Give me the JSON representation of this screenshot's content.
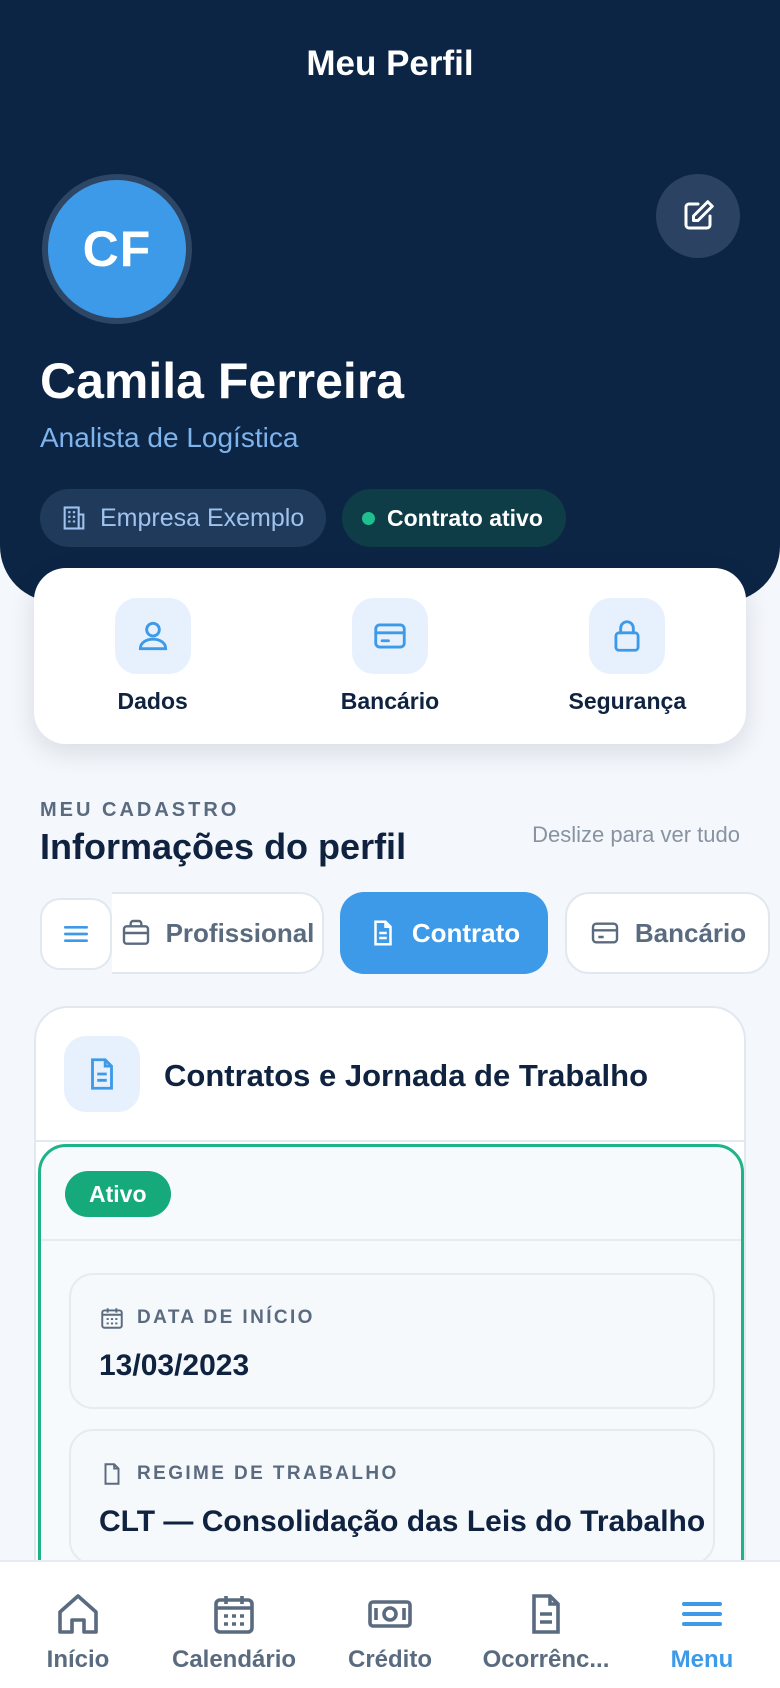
{
  "header": {
    "title": "Meu Perfil"
  },
  "profile": {
    "initials": "CF",
    "name": "Camila Ferreira",
    "role": "Analista de Logística",
    "company": "Empresa Exemplo",
    "contract_status": "Contrato ativo"
  },
  "quick_actions": [
    {
      "label": "Dados",
      "icon": "user-icon"
    },
    {
      "label": "Bancário",
      "icon": "card-icon"
    },
    {
      "label": "Segurança",
      "icon": "lock-icon"
    }
  ],
  "section": {
    "kicker": "MEU CADASTRO",
    "title": "Informações do perfil",
    "hint": "Deslize para ver tudo"
  },
  "tabs": [
    {
      "label": "Profissional",
      "icon": "briefcase-icon",
      "active": false
    },
    {
      "label": "Contrato",
      "icon": "document-icon",
      "active": true
    },
    {
      "label": "Bancário",
      "icon": "card-icon",
      "active": false
    }
  ],
  "contracts": {
    "title": "Contratos e Jornada de Trabalho",
    "status": "Ativo",
    "fields": [
      {
        "label": "DATA DE INÍCIO",
        "value": "13/03/2023",
        "icon": "calendar-icon"
      },
      {
        "label": "REGIME DE TRABALHO",
        "value": "CLT — Consolidação das Leis do Trabalho",
        "icon": "file-icon"
      }
    ]
  },
  "bottom_nav": [
    {
      "label": "Início",
      "icon": "home-icon",
      "active": false
    },
    {
      "label": "Calendário",
      "icon": "calendar-icon",
      "active": false
    },
    {
      "label": "Crédito",
      "icon": "money-icon",
      "active": false
    },
    {
      "label": "Ocorrênc...",
      "icon": "document-icon",
      "active": false
    },
    {
      "label": "Menu",
      "icon": "menu-icon",
      "active": true
    }
  ],
  "colors": {
    "header_bg": "#0c2545",
    "accent": "#3d9ae8",
    "success": "#16a97a",
    "text_primary": "#0f2340",
    "text_muted": "#5a6b80"
  }
}
